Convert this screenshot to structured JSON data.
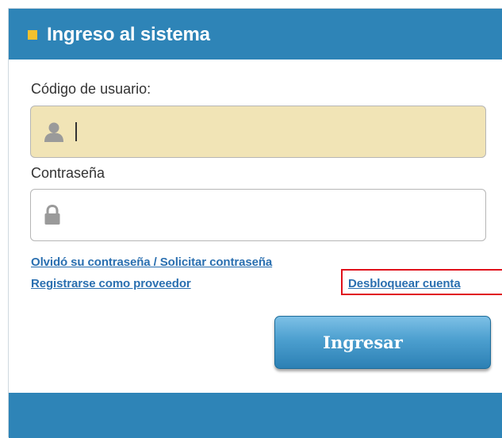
{
  "header": {
    "title": "Ingreso al sistema",
    "accent_color": "#f2c12e",
    "bg_color": "#2e84b7"
  },
  "form": {
    "user_label": "Código de usuario:",
    "user_value": "",
    "user_icon": "user-icon",
    "user_bg_color": "#f1e4b6",
    "password_label": "Contraseña",
    "password_value": "",
    "password_icon": "lock-icon"
  },
  "links": {
    "forgot": "Olvidó su contraseña / Solicitar contraseña",
    "register": "Registrarse como proveedor",
    "unlock": "Desbloquear cuenta",
    "highlight_color": "#e0111b"
  },
  "actions": {
    "submit_label": "Ingresar"
  }
}
